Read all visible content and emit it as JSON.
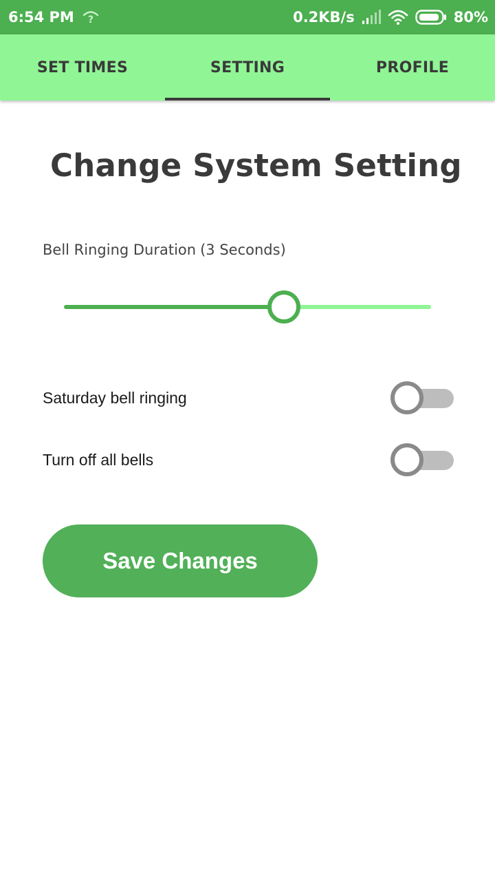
{
  "status_bar": {
    "time": "6:54 PM",
    "network_speed": "0.2KB/s",
    "battery": "80%",
    "icons": [
      "wifi-question-icon",
      "signal-icon",
      "wifi-icon",
      "battery-icon"
    ]
  },
  "tabs": [
    {
      "label": "SET TIMES",
      "active": false
    },
    {
      "label": "SETTING",
      "active": true
    },
    {
      "label": "PROFILE",
      "active": false
    }
  ],
  "title": "Change System Setting",
  "duration": {
    "label": "Bell Ringing Duration",
    "value_text": "(3 Seconds)",
    "slider_fraction": 0.6
  },
  "toggles": [
    {
      "label": "Saturday bell ringing",
      "checked": false
    },
    {
      "label": "Turn off all bells",
      "checked": false
    }
  ],
  "save_button": {
    "label": "Save Changes"
  },
  "colors": {
    "status_bar": "#4caf50",
    "tab_bar": "#90f595",
    "accent": "#4caf50",
    "button": "#52b058"
  }
}
